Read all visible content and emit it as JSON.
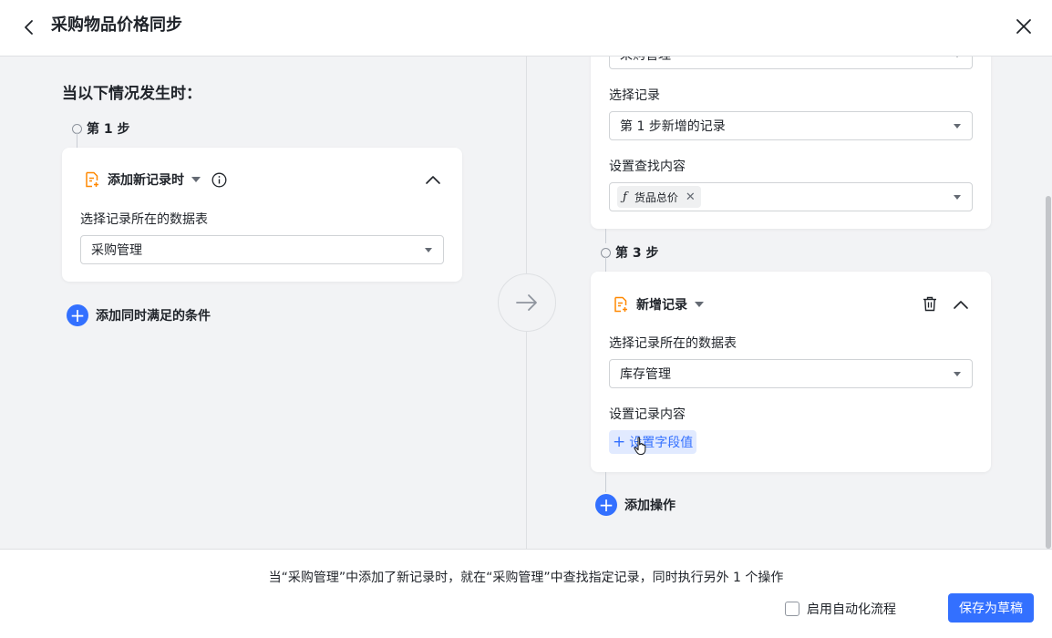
{
  "header": {
    "title": "采购物品价格同步",
    "back_icon": "chevron-left-icon",
    "close_icon": "close-icon"
  },
  "trigger": {
    "heading": "当以下情况发生时：",
    "step_label": "第 1 步",
    "card_title": "添加新记录时",
    "table_label": "选择记录所在的数据表",
    "table_value": "采购管理",
    "add_condition_label": "添加同时满足的条件"
  },
  "step2": {
    "top_select_value": "采购管理",
    "record_label": "选择记录",
    "record_value": "第 1 步新增的记录",
    "find_label": "设置查找内容",
    "find_tag": "货品总价"
  },
  "step3": {
    "step_label": "第 3 步",
    "card_title": "新增记录",
    "table_label": "选择记录所在的数据表",
    "table_value": "库存管理",
    "content_label": "设置记录内容",
    "set_field_label": "设置字段值"
  },
  "add_action_label": "添加操作",
  "footer": {
    "summary": "当“采购管理”中添加了新记录时，就在“采购管理”中查找指定记录，同时执行另外 1 个操作",
    "enable_label": "启用自动化流程",
    "save_label": "保存为草稿"
  },
  "colors": {
    "primary": "#3370ff",
    "icon_orange": "#ff8800",
    "canvas_bg": "#f2f3f5"
  }
}
